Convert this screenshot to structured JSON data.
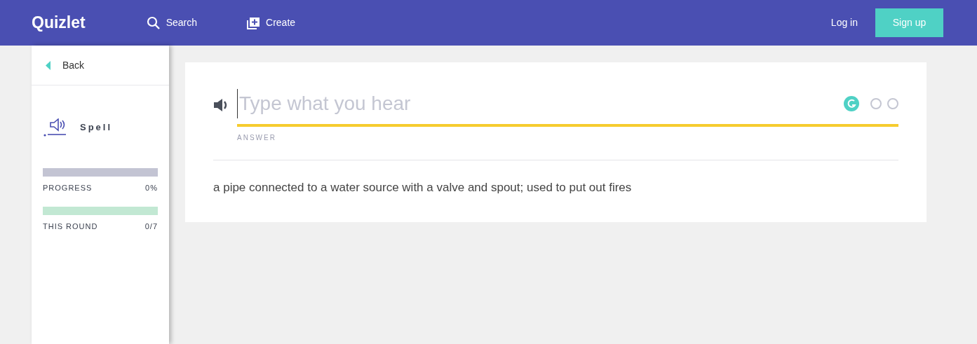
{
  "navbar": {
    "logo": "Quizlet",
    "links": [
      {
        "kind": "search",
        "label": "Search"
      },
      {
        "kind": "create",
        "label": "Create"
      }
    ],
    "login": "Log in",
    "signup": "Sign up"
  },
  "sidebar": {
    "back": "Back",
    "mode": "Spell",
    "meters": [
      {
        "label": "PROGRESS",
        "reading": "0%",
        "level": 0,
        "color": "#c3c4d3"
      },
      {
        "label": "THIS ROUND",
        "reading": "0/7",
        "level": 0,
        "color": "#c2e8d3"
      }
    ]
  },
  "question": {
    "answer_field": {
      "placeholder": "Type what you hear",
      "label": "ANSWER"
    },
    "definition": "a pipe connected to a water source with a valve and spout; used to put out fires"
  }
}
